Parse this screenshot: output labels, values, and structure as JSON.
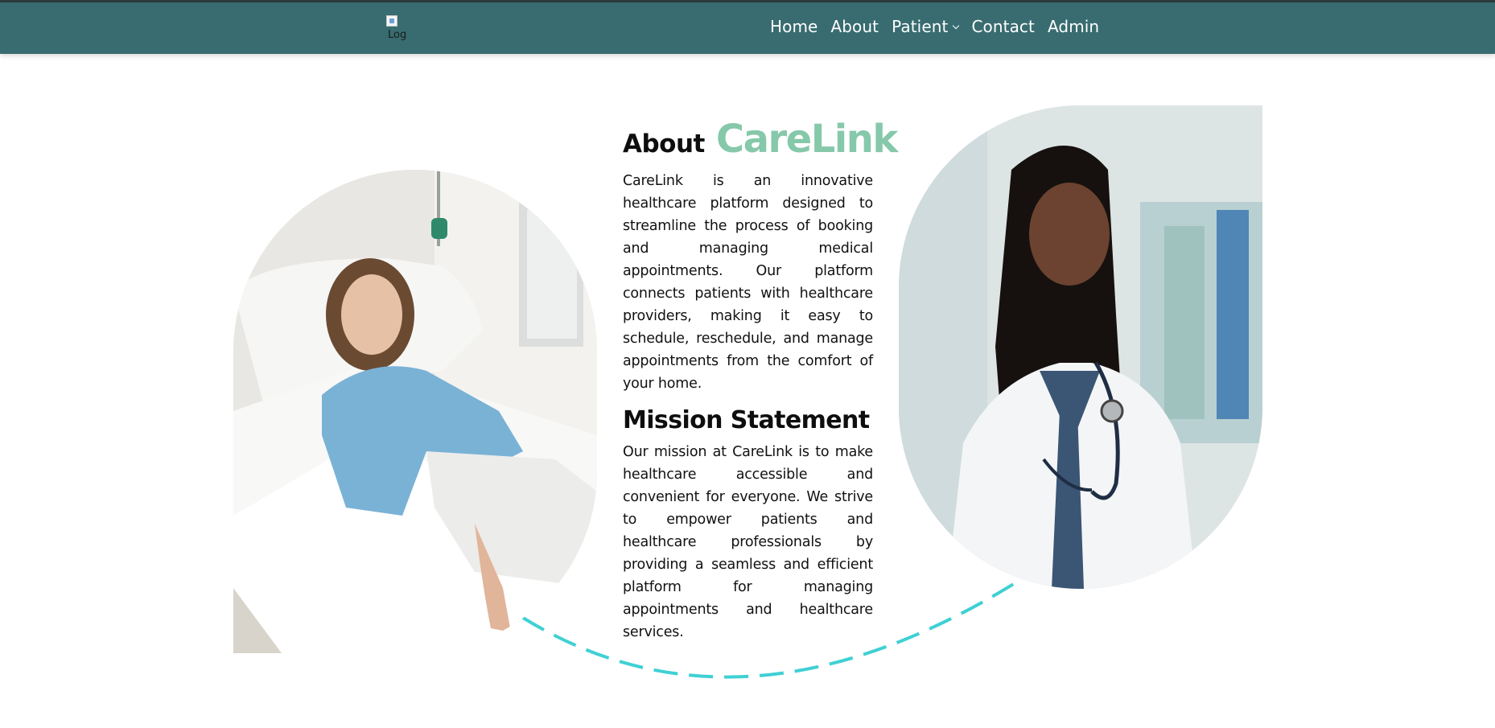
{
  "navbar": {
    "logo_alt": "Log",
    "links": [
      {
        "label": "Home"
      },
      {
        "label": "About"
      },
      {
        "label": "Patient",
        "has_dropdown": true
      },
      {
        "label": "Contact"
      },
      {
        "label": "Admin"
      }
    ]
  },
  "about": {
    "heading_prefix": "About",
    "heading_brand": "CareLink",
    "description": "CareLink is an innovative healthcare platform designed to streamline the process of booking and managing medical appointments. Our platform connects patients with healthcare providers, making it easy to schedule, reschedule, and manage appointments from the comfort of your home."
  },
  "mission": {
    "heading": "Mission Statement",
    "text": "Our mission at CareLink is to make healthcare accessible and convenient for everyone. We strive to empower patients and healthcare professionals by providing a seamless and efficient platform for managing appointments and healthcare services."
  },
  "images": {
    "left": "patient-in-hospital-bed-photo",
    "right": "doctor-with-stethoscope-photo"
  },
  "colors": {
    "navbar": "#386c70",
    "brand": "#86c8aa",
    "dashed_arc": "#3fd0d4"
  }
}
